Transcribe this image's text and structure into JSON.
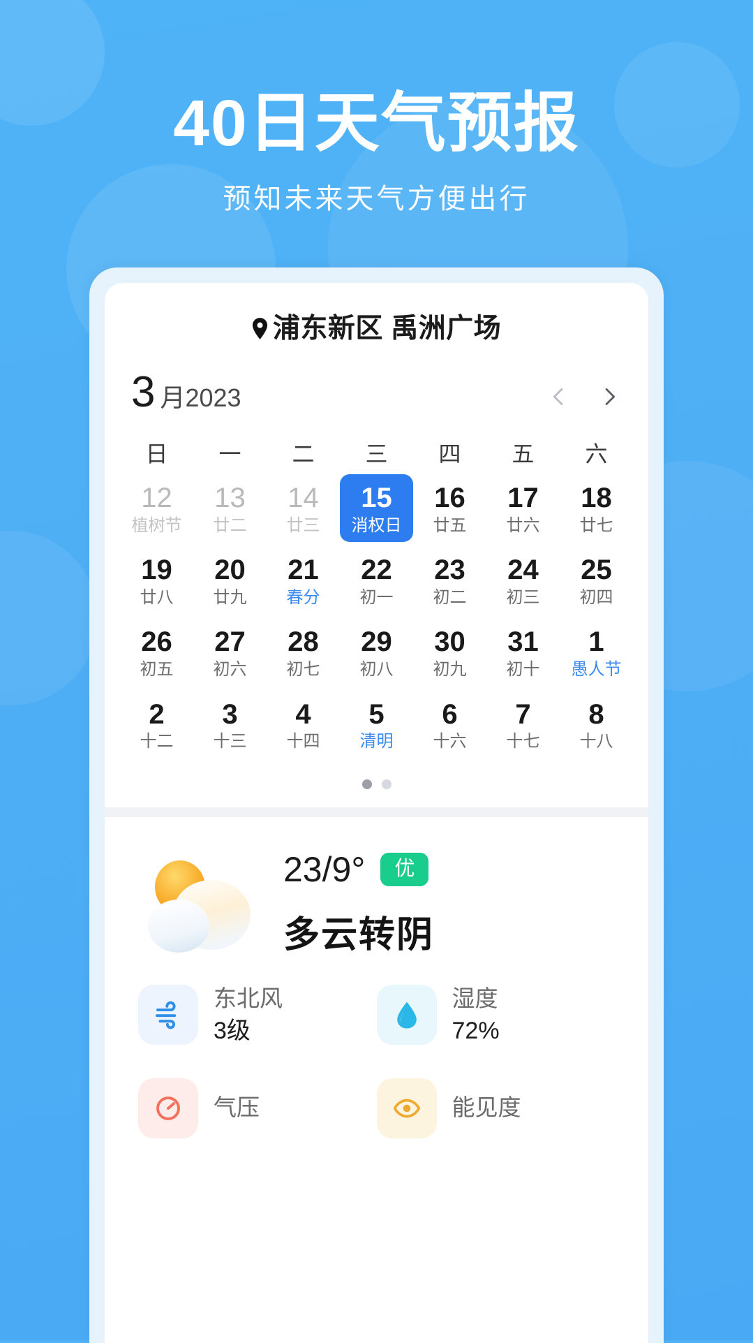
{
  "hero": {
    "title": "40日天气预报",
    "subtitle": "预知未来天气方便出行"
  },
  "colors": {
    "background_top": "#4FB3F7",
    "accent_blue": "#2D7DF0",
    "festive_blue": "#3E8BF0",
    "aqi_green": "#19CE8C"
  },
  "card": {
    "location": {
      "icon": "location-pin-icon",
      "district": "浦东新区",
      "place": "禹洲广场",
      "text": "浦东新区 禹洲广场"
    },
    "calendar": {
      "month_number": "3",
      "month_year_label": "月2023",
      "prev_icon": "chevron-left-icon",
      "next_icon": "chevron-right-icon",
      "weekdays": [
        "日",
        "一",
        "二",
        "三",
        "四",
        "五",
        "六"
      ],
      "days": [
        {
          "day": "12",
          "lunar": "植树节",
          "muted": true,
          "selected": false,
          "festive": false
        },
        {
          "day": "13",
          "lunar": "廿二",
          "muted": true,
          "selected": false,
          "festive": false
        },
        {
          "day": "14",
          "lunar": "廿三",
          "muted": true,
          "selected": false,
          "festive": false
        },
        {
          "day": "15",
          "lunar": "消权日",
          "muted": false,
          "selected": true,
          "festive": false
        },
        {
          "day": "16",
          "lunar": "廿五",
          "muted": false,
          "selected": false,
          "festive": false
        },
        {
          "day": "17",
          "lunar": "廿六",
          "muted": false,
          "selected": false,
          "festive": false
        },
        {
          "day": "18",
          "lunar": "廿七",
          "muted": false,
          "selected": false,
          "festive": false
        },
        {
          "day": "19",
          "lunar": "廿八",
          "muted": false,
          "selected": false,
          "festive": false
        },
        {
          "day": "20",
          "lunar": "廿九",
          "muted": false,
          "selected": false,
          "festive": false
        },
        {
          "day": "21",
          "lunar": "春分",
          "muted": false,
          "selected": false,
          "festive": true
        },
        {
          "day": "22",
          "lunar": "初一",
          "muted": false,
          "selected": false,
          "festive": false
        },
        {
          "day": "23",
          "lunar": "初二",
          "muted": false,
          "selected": false,
          "festive": false
        },
        {
          "day": "24",
          "lunar": "初三",
          "muted": false,
          "selected": false,
          "festive": false
        },
        {
          "day": "25",
          "lunar": "初四",
          "muted": false,
          "selected": false,
          "festive": false
        },
        {
          "day": "26",
          "lunar": "初五",
          "muted": false,
          "selected": false,
          "festive": false
        },
        {
          "day": "27",
          "lunar": "初六",
          "muted": false,
          "selected": false,
          "festive": false
        },
        {
          "day": "28",
          "lunar": "初七",
          "muted": false,
          "selected": false,
          "festive": false
        },
        {
          "day": "29",
          "lunar": "初八",
          "muted": false,
          "selected": false,
          "festive": false
        },
        {
          "day": "30",
          "lunar": "初九",
          "muted": false,
          "selected": false,
          "festive": false
        },
        {
          "day": "31",
          "lunar": "初十",
          "muted": false,
          "selected": false,
          "festive": false
        },
        {
          "day": "1",
          "lunar": "愚人节",
          "muted": false,
          "selected": false,
          "festive": true
        },
        {
          "day": "2",
          "lunar": "十二",
          "muted": false,
          "selected": false,
          "festive": false
        },
        {
          "day": "3",
          "lunar": "十三",
          "muted": false,
          "selected": false,
          "festive": false
        },
        {
          "day": "4",
          "lunar": "十四",
          "muted": false,
          "selected": false,
          "festive": false
        },
        {
          "day": "5",
          "lunar": "清明",
          "muted": false,
          "selected": false,
          "festive": true
        },
        {
          "day": "6",
          "lunar": "十六",
          "muted": false,
          "selected": false,
          "festive": false
        },
        {
          "day": "7",
          "lunar": "十七",
          "muted": false,
          "selected": false,
          "festive": false
        },
        {
          "day": "8",
          "lunar": "十八",
          "muted": false,
          "selected": false,
          "festive": false
        }
      ],
      "pager": {
        "count": 2,
        "active_index": 0
      }
    },
    "weather": {
      "icon": "partly-cloudy-sun-icon",
      "temperature": "23/9°",
      "aqi_label": "优",
      "condition": "多云转阴",
      "details": [
        {
          "icon": "wind-icon",
          "tone": "wind",
          "label": "东北风",
          "value": "3级"
        },
        {
          "icon": "water-drop-icon",
          "tone": "humid",
          "label": "湿度",
          "value": "72%"
        },
        {
          "icon": "pressure-icon",
          "tone": "press",
          "label": "气压",
          "value": ""
        },
        {
          "icon": "visibility-icon",
          "tone": "vis",
          "label": "能见度",
          "value": ""
        }
      ]
    }
  }
}
